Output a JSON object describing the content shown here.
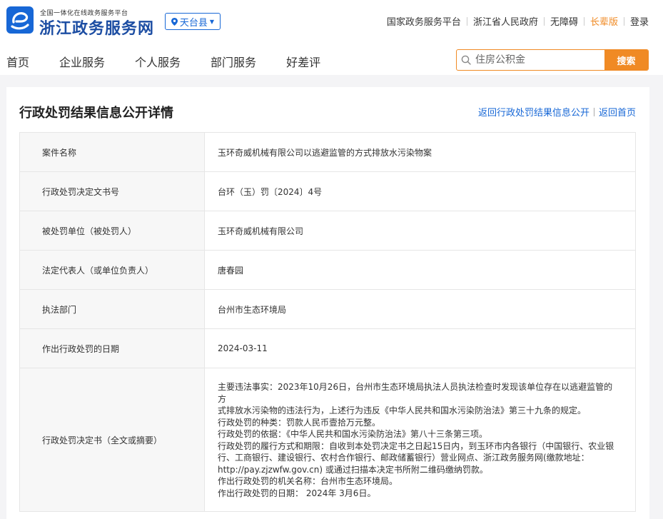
{
  "header": {
    "logo_small": "全国一体化在线政务服务平台",
    "logo_big": "浙江政务服务网",
    "region": "天台县",
    "top_links": [
      "国家政务服务平台",
      "浙江省人民政府",
      "无障碍",
      "长辈版",
      "登录"
    ]
  },
  "nav": [
    "首页",
    "企业服务",
    "个人服务",
    "部门服务",
    "好差评"
  ],
  "search": {
    "placeholder": "住房公积金",
    "button": "搜索"
  },
  "page": {
    "title": "行政处罚结果信息公开详情",
    "back_list": "返回行政处罚结果信息公开",
    "back_home": "返回首页"
  },
  "details": [
    {
      "label": "案件名称",
      "value": "玉环奇威机械有限公司以逃避监管的方式排放水污染物案"
    },
    {
      "label": "行政处罚决定文书号",
      "value": "台环（玉）罚〔2024〕4号"
    },
    {
      "label": "被处罚单位（被处罚人）",
      "value": "玉环奇威机械有限公司"
    },
    {
      "label": "法定代表人（或单位负责人）",
      "value": "唐春园"
    },
    {
      "label": "执法部门",
      "value": "台州市生态环境局"
    },
    {
      "label": "作出行政处罚的日期",
      "value": "2024-03-11"
    }
  ],
  "decision": {
    "label": "行政处罚决定书（全文或摘要）",
    "lines": [
      "主要违法事实：2023年10月26日，台州市生态环境局执法人员执法检查时发现该单位存在以逃避监管的方",
      "式排放水污染物的违法行为，上述行为违反《中华人民共和国水污染防治法》第三十九条的规定。",
      "行政处罚的种类：罚款人民币壹拾万元整。",
      "行政处罚的依据：《中华人民共和国水污染防治法》第八十三条第三项。",
      "行政处罚的履行方式和期限：自收到本处罚决定书之日起15日内，到玉环市内各银行（中国银行、农业银",
      "行、工商银行、建设银行、农村合作银行、邮政储蓄银行）营业网点、浙江政务服务网(缴款地址：",
      "http://pay.zjzwfw.gov.cn) 或通过扫描本决定书所附二维码缴纳罚款。",
      "作出行政处罚的机关名称：台州市生态环境局。",
      "作出行政处罚的日期： 2024年 3月6日。"
    ]
  },
  "colors": {
    "brand_blue": "#1767d6",
    "accent_orange": "#f08a24"
  }
}
